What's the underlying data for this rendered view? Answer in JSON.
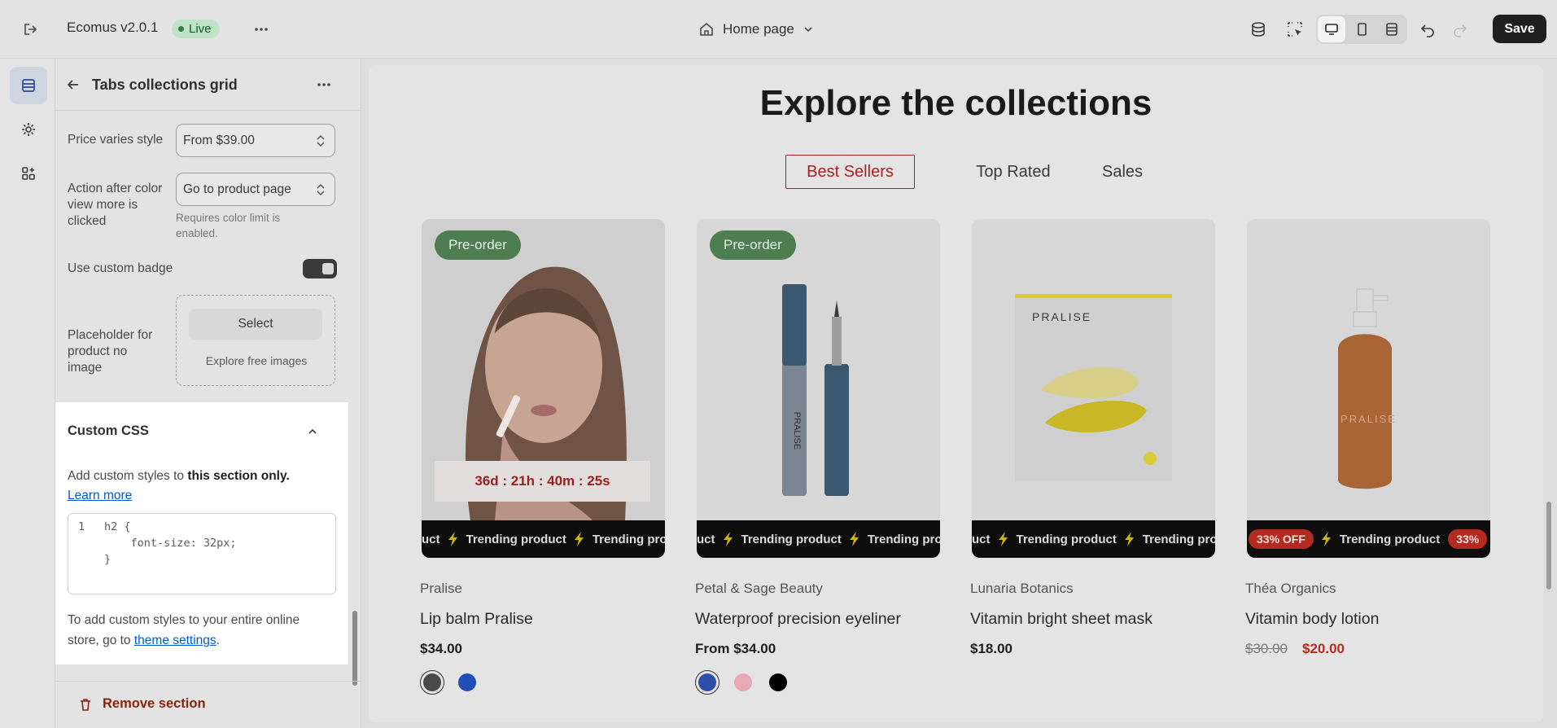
{
  "topbar": {
    "app_title": "Ecomus v2.0.1",
    "status": "Live",
    "page_selector": "Home page",
    "save_label": "Save",
    "icons": [
      "exit-icon",
      "more-horizontal-icon",
      "home-icon",
      "chevron-down-icon",
      "database-icon",
      "inspect-icon",
      "desktop-icon",
      "mobile-icon",
      "fullwidth-icon",
      "undo-icon",
      "redo-icon"
    ]
  },
  "rail": {
    "items": [
      "sections-icon",
      "settings-icon",
      "apps-icon"
    ]
  },
  "panel": {
    "title": "Tabs collections grid",
    "price_varies": {
      "label": "Price varies style",
      "value": "From $39.00"
    },
    "action_color": {
      "label_1": "Action after color",
      "label_2": "view more is",
      "label_3": "clicked",
      "value": "Go to product page",
      "help_1": "Requires color limit is",
      "help_2": "enabled."
    },
    "custom_badge": {
      "label": "Use custom badge",
      "enabled": true
    },
    "placeholder": {
      "label_1": "Placeholder for",
      "label_2": "product no",
      "label_3": "image",
      "select_label": "Select",
      "explore_label": "Explore free images"
    },
    "custom_css": {
      "title": "Custom CSS",
      "desc_prefix": "Add custom styles to ",
      "desc_bold": "this section only.",
      "learn_more": "Learn more",
      "code_lines": [
        {
          "n": "1",
          "text": "h2 {"
        },
        {
          "n": "",
          "text": "    font-size: 32px;"
        },
        {
          "n": "",
          "text": "}"
        }
      ],
      "footer_1": "To add custom styles to your entire online",
      "footer_2": "store, go to ",
      "footer_link": "theme settings",
      "footer_end": "."
    },
    "remove_label": "Remove section"
  },
  "preview": {
    "heading": "Explore the collections",
    "tabs": [
      "Best Sellers",
      "Top Rated",
      "Sales"
    ],
    "active_tab": "Best Sellers",
    "marquee_text": "Trending product",
    "marquee_lead": "uct",
    "products": [
      {
        "badge": "Pre-order",
        "countdown": "36d : 21h : 40m : 25s",
        "vendor": "Pralise",
        "name": "Lip balm Pralise",
        "price": "$34.00",
        "swatches": [
          "#4a4a4a",
          "#1f4fb5"
        ]
      },
      {
        "badge": "Pre-order",
        "vendor": "Petal & Sage Beauty",
        "name": "Waterproof precision eyeliner",
        "price": "From $34.00",
        "swatches": [
          "#2d4fa8",
          "#e8a8b6",
          "#000000"
        ]
      },
      {
        "vendor": "Lunaria Botanics",
        "name": "Vitamin bright sheet mask",
        "price": "$18.00",
        "image_brand": "PRALISE"
      },
      {
        "vendor": "Théa Organics",
        "name": "Vitamin body lotion",
        "price_old": "$30.00",
        "price_sale": "$20.00",
        "off_badge": "33% OFF",
        "off_badge_short": "33%",
        "image_brand": "PRALISE"
      }
    ]
  },
  "colors": {
    "accent_red": "#b01f1f",
    "live_green": "#c0e2c6",
    "preorder_green": "#4d7d51",
    "link_blue": "#005bd3"
  }
}
